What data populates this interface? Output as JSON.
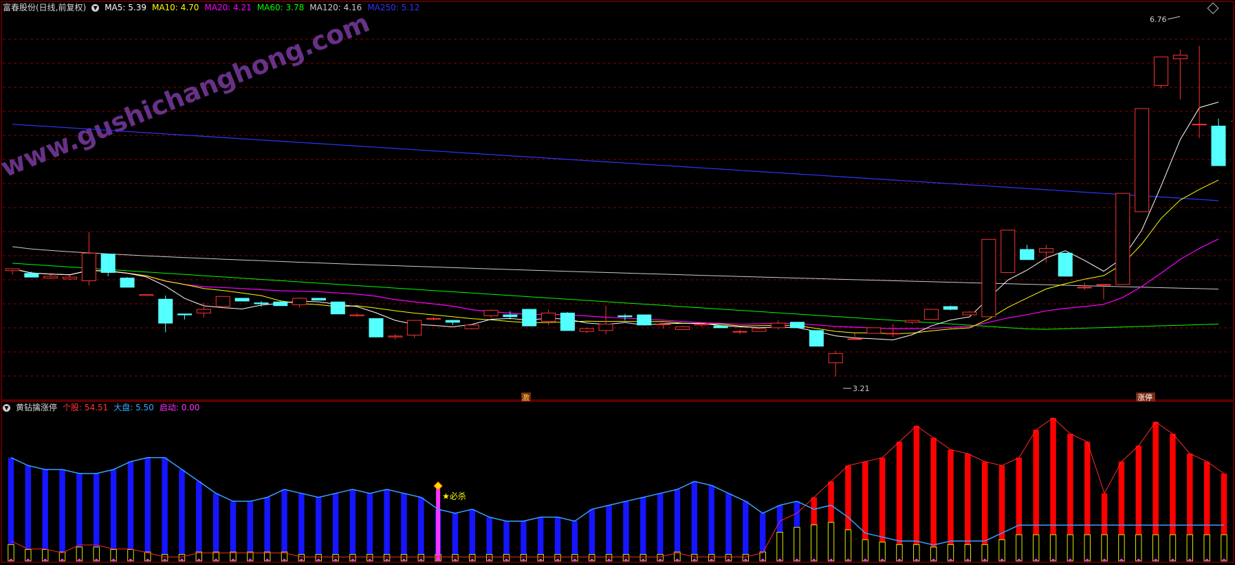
{
  "main_header": {
    "stock": "富春股份(日线,前复权)",
    "ma": [
      {
        "label": "MA5:",
        "value": "5.39",
        "color": "#ffffff"
      },
      {
        "label": "MA10:",
        "value": "4.70",
        "color": "#ffff00"
      },
      {
        "label": "MA20:",
        "value": "4.21",
        "color": "#ff00ff"
      },
      {
        "label": "MA60:",
        "value": "3.78",
        "color": "#00ff00"
      },
      {
        "label": "MA120:",
        "value": "4.16",
        "color": "#cccccc"
      },
      {
        "label": "MA250:",
        "value": "5.12",
        "color": "#3333ff"
      }
    ]
  },
  "watermark": "www.gushichanghong.com",
  "annotations": {
    "high": "6.76",
    "low": "3.21",
    "tag_left": "激",
    "tag_right": "涨停",
    "signal": "★必杀"
  },
  "sub_header": {
    "name": "黄钻擒涨停",
    "items": [
      {
        "label": "个股:",
        "value": "54.51",
        "color": "#ff3333"
      },
      {
        "label": "大盘:",
        "value": "5.50",
        "color": "#33aaff"
      },
      {
        "label": "启动:",
        "value": "0.00",
        "color": "#ff33ff"
      }
    ]
  },
  "colors": {
    "up": "#ff3232",
    "down": "#54ffff",
    "grid": "#8b0000",
    "frame": "#b00000"
  },
  "chart_data": [
    {
      "type": "candlestick",
      "title": "富春股份(日线,前复权)",
      "price_range": [
        3.0,
        7.0
      ],
      "candles": [
        [
          4.36,
          4.38,
          4.32,
          4.38
        ],
        [
          4.33,
          4.35,
          4.29,
          4.29
        ],
        [
          4.28,
          4.32,
          4.27,
          4.3
        ],
        [
          4.27,
          4.31,
          4.26,
          4.29
        ],
        [
          4.25,
          4.78,
          4.2,
          4.55
        ],
        [
          4.54,
          4.54,
          4.3,
          4.34
        ],
        [
          4.28,
          4.29,
          4.18,
          4.18
        ],
        [
          4.09,
          4.1,
          4.09,
          4.1
        ],
        [
          4.05,
          4.09,
          3.69,
          3.79
        ],
        [
          3.89,
          3.89,
          3.83,
          3.88
        ],
        [
          3.9,
          4.01,
          3.85,
          3.94
        ],
        [
          3.97,
          4.08,
          3.97,
          4.08
        ],
        [
          4.06,
          4.06,
          4.03,
          4.03
        ],
        [
          4.01,
          4.03,
          3.97,
          4.0
        ],
        [
          4.02,
          4.03,
          3.98,
          3.98
        ],
        [
          3.99,
          4.07,
          3.96,
          4.06
        ],
        [
          4.06,
          4.06,
          4.04,
          4.04
        ],
        [
          4.02,
          4.02,
          3.89,
          3.89
        ],
        [
          3.87,
          3.9,
          3.86,
          3.88
        ],
        [
          3.84,
          3.84,
          3.64,
          3.64
        ],
        [
          3.64,
          3.67,
          3.61,
          3.65
        ],
        [
          3.66,
          3.82,
          3.63,
          3.82
        ],
        [
          3.84,
          3.86,
          3.82,
          3.84
        ],
        [
          3.82,
          3.82,
          3.77,
          3.8
        ],
        [
          3.73,
          3.78,
          3.72,
          3.77
        ],
        [
          3.87,
          3.94,
          3.85,
          3.93
        ],
        [
          3.88,
          3.92,
          3.83,
          3.86
        ],
        [
          3.94,
          3.94,
          3.76,
          3.76
        ],
        [
          3.81,
          3.94,
          3.77,
          3.9
        ],
        [
          3.9,
          3.91,
          3.71,
          3.71
        ],
        [
          3.7,
          3.74,
          3.68,
          3.73
        ],
        [
          3.71,
          3.98,
          3.67,
          3.78
        ],
        [
          3.87,
          3.89,
          3.82,
          3.86
        ],
        [
          3.88,
          3.88,
          3.77,
          3.77
        ],
        [
          3.78,
          3.79,
          3.73,
          3.78
        ],
        [
          3.72,
          3.76,
          3.72,
          3.75
        ],
        [
          3.77,
          3.79,
          3.75,
          3.78
        ],
        [
          3.76,
          3.77,
          3.74,
          3.74
        ],
        [
          3.7,
          3.72,
          3.67,
          3.7
        ],
        [
          3.7,
          3.74,
          3.7,
          3.73
        ],
        [
          3.74,
          3.82,
          3.72,
          3.79
        ],
        [
          3.8,
          3.8,
          3.74,
          3.74
        ],
        [
          3.71,
          3.71,
          3.54,
          3.54
        ],
        [
          3.36,
          3.49,
          3.21,
          3.46
        ],
        [
          3.62,
          3.68,
          3.61,
          3.62
        ],
        [
          3.68,
          3.74,
          3.68,
          3.74
        ],
        [
          3.68,
          3.78,
          3.64,
          3.68
        ],
        [
          3.8,
          3.82,
          3.78,
          3.82
        ],
        [
          3.83,
          3.94,
          3.83,
          3.94
        ],
        [
          3.97,
          3.98,
          3.93,
          3.94
        ],
        [
          3.88,
          3.92,
          3.88,
          3.91
        ],
        [
          3.86,
          4.7,
          3.86,
          4.7
        ],
        [
          4.34,
          4.8,
          4.34,
          4.8
        ],
        [
          4.59,
          4.64,
          4.48,
          4.48
        ],
        [
          4.56,
          4.64,
          4.45,
          4.6
        ],
        [
          4.55,
          4.55,
          4.3,
          4.3
        ],
        [
          4.18,
          4.23,
          4.15,
          4.18
        ],
        [
          4.21,
          4.21,
          4.05,
          4.21
        ],
        [
          4.21,
          5.2,
          4.21,
          5.2
        ],
        [
          5.0,
          6.12,
          5.0,
          6.12
        ],
        [
          6.37,
          6.65,
          6.34,
          6.68
        ],
        [
          6.66,
          6.76,
          6.22,
          6.7
        ],
        [
          5.95,
          6.8,
          5.8,
          5.95
        ],
        [
          5.93,
          6.01,
          5.5,
          5.5
        ]
      ]
    },
    {
      "type": "bar",
      "title": "黄钻擒涨停",
      "series": [
        {
          "name": "个股",
          "values": [
            5,
            3,
            3,
            2,
            4,
            4,
            3,
            3,
            2,
            1,
            1,
            2,
            2,
            2,
            2,
            2,
            2,
            1,
            1,
            1,
            1,
            1,
            1,
            1,
            1,
            1,
            1,
            1,
            1,
            1,
            1,
            1,
            1,
            1,
            1,
            1,
            1,
            1,
            1,
            2,
            1,
            1,
            1,
            1,
            2,
            10,
            12,
            16,
            20,
            24,
            25,
            26,
            30,
            34,
            31,
            28,
            27,
            25,
            24,
            26,
            33,
            36,
            32,
            30,
            17,
            25,
            29,
            35,
            32,
            27,
            25,
            22
          ]
        },
        {
          "name": "大盘",
          "values": [
            26,
            24,
            23,
            23,
            22,
            22,
            23,
            25,
            26,
            26,
            23,
            20,
            17,
            15,
            15,
            16,
            18,
            17,
            16,
            17,
            18,
            17,
            18,
            17,
            16,
            13,
            12,
            13,
            11,
            10,
            10,
            11,
            11,
            10,
            13,
            14,
            15,
            16,
            17,
            18,
            20,
            19,
            17,
            15,
            12,
            14,
            15,
            13,
            14,
            11,
            7,
            6,
            5,
            5,
            4,
            5,
            5,
            5,
            7,
            9,
            9,
            9,
            9,
            9,
            9,
            9,
            9,
            9,
            9,
            9,
            9,
            9
          ]
        },
        {
          "name": "启动",
          "values": [
            0
          ]
        }
      ]
    }
  ]
}
